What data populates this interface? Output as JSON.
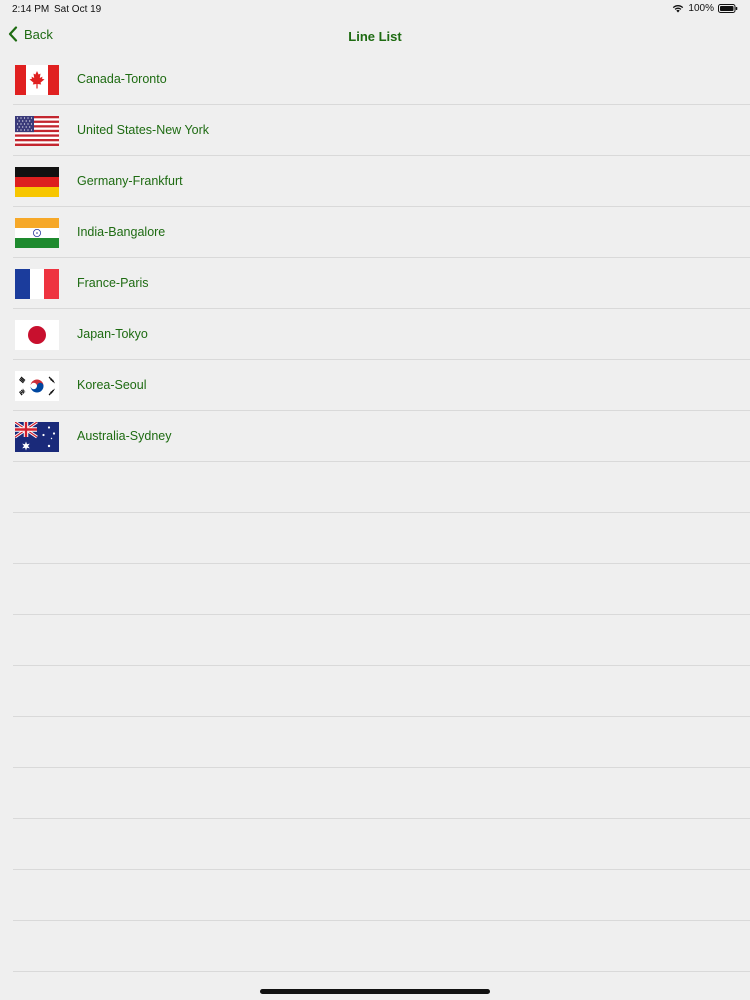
{
  "status": {
    "time": "2:14 PM",
    "date": "Sat Oct 19",
    "battery": "100%"
  },
  "nav": {
    "back_label": "Back",
    "title": "Line List"
  },
  "colors": {
    "accent": "#1e6b12",
    "background": "#efefef",
    "separator": "#d9d9d9"
  },
  "lines": [
    {
      "label": "Canada-Toronto",
      "flag_icon": "canada-flag-icon"
    },
    {
      "label": "United States-New York",
      "flag_icon": "usa-flag-icon"
    },
    {
      "label": "Germany-Frankfurt",
      "flag_icon": "germany-flag-icon"
    },
    {
      "label": "India-Bangalore",
      "flag_icon": "india-flag-icon"
    },
    {
      "label": "France-Paris",
      "flag_icon": "france-flag-icon"
    },
    {
      "label": "Japan-Tokyo",
      "flag_icon": "japan-flag-icon"
    },
    {
      "label": "Korea-Seoul",
      "flag_icon": "korea-flag-icon"
    },
    {
      "label": "Australia-Sydney",
      "flag_icon": "australia-flag-icon"
    }
  ]
}
